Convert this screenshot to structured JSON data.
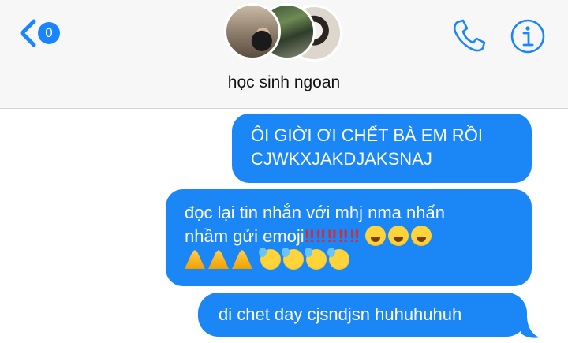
{
  "header": {
    "unread_count": "0",
    "group_name": "học sinh ngoan",
    "icons": [
      "chevron-left-icon",
      "phone-icon",
      "info-icon"
    ],
    "accent_color": "#1a85ff"
  },
  "messages": [
    {
      "line1": "ÔI GIỜI ƠI CHẾT BÀ EM RỒI",
      "line2": "CJWKXJAKDJAKSNAJ"
    },
    {
      "line1": "đọc lại tin nhắn với mhj nma nhấn",
      "line2_text": "nhầm gửi emoji",
      "line2_marks": "‼‼‼‼‼",
      "emoji_counts": {
        "crying": 3,
        "pray": 3,
        "sweat": 4
      }
    },
    {
      "text": "di chet day cjsndjsn huhuhuhuh"
    }
  ],
  "bubble_color": "#1b86f6"
}
